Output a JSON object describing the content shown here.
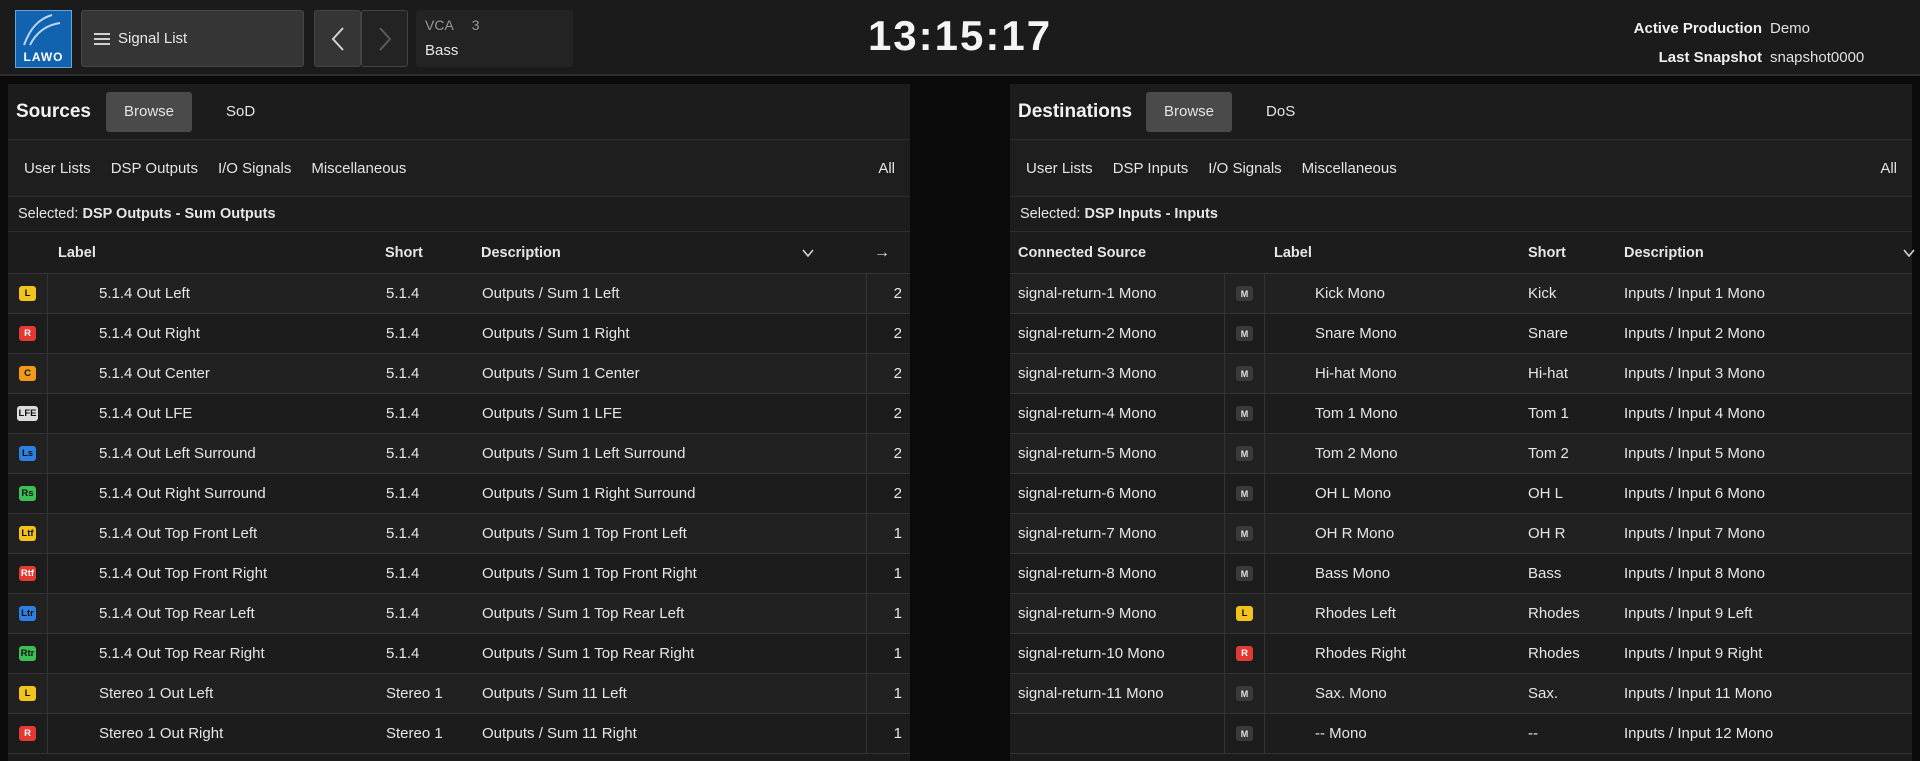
{
  "header": {
    "logo_text": "LAWO",
    "menu_label": "Signal List",
    "vca_label": "VCA",
    "vca_number": "3",
    "vca_name": "Bass",
    "clock": "13:15:17",
    "active_production_label": "Active Production",
    "active_production_value": "Demo",
    "last_snapshot_label": "Last Snapshot",
    "last_snapshot_value": "snapshot0000"
  },
  "sources": {
    "title": "Sources",
    "tabs": [
      "Browse",
      "SoD"
    ],
    "filters": [
      "User Lists",
      "DSP Outputs",
      "I/O Signals",
      "Miscellaneous"
    ],
    "filter_all": "All",
    "selected_prefix": "Selected:",
    "selected_value": "DSP Outputs - Sum Outputs",
    "columns": {
      "label": "Label",
      "short": "Short",
      "description": "Description",
      "arrow": "→"
    },
    "rows": [
      {
        "badge": "L",
        "badge_color": "#f2c31c",
        "label": "5.1.4 Out Left",
        "short": "5.1.4",
        "description": "Outputs / Sum 1 Left",
        "count": "2"
      },
      {
        "badge": "R",
        "badge_color": "#e23a32",
        "label": "5.1.4 Out Right",
        "short": "5.1.4",
        "description": "Outputs / Sum 1 Right",
        "count": "2"
      },
      {
        "badge": "C",
        "badge_color": "#f09a1a",
        "label": "5.1.4 Out Center",
        "short": "5.1.4",
        "description": "Outputs / Sum 1 Center",
        "count": "2"
      },
      {
        "badge": "LFE",
        "badge_color": "#dcdcdc",
        "label": "5.1.4 Out LFE",
        "short": "5.1.4",
        "description": "Outputs / Sum 1 LFE",
        "count": "2"
      },
      {
        "badge": "Ls",
        "badge_color": "#2d7fe0",
        "label": "5.1.4 Out Left Surround",
        "short": "5.1.4",
        "description": "Outputs / Sum 1 Left Surround",
        "count": "2"
      },
      {
        "badge": "Rs",
        "badge_color": "#3cbf55",
        "label": "5.1.4 Out Right Surround",
        "short": "5.1.4",
        "description": "Outputs / Sum 1 Right Surround",
        "count": "2"
      },
      {
        "badge": "Ltf",
        "badge_color": "#f2c31c",
        "label": "5.1.4 Out Top Front Left",
        "short": "5.1.4",
        "description": "Outputs / Sum 1 Top Front Left",
        "count": "1"
      },
      {
        "badge": "Rtf",
        "badge_color": "#e23a32",
        "label": "5.1.4 Out Top Front Right",
        "short": "5.1.4",
        "description": "Outputs / Sum 1 Top Front Right",
        "count": "1"
      },
      {
        "badge": "Ltr",
        "badge_color": "#2d7fe0",
        "label": "5.1.4 Out Top Rear Left",
        "short": "5.1.4",
        "description": "Outputs / Sum 1 Top Rear Left",
        "count": "1"
      },
      {
        "badge": "Rtr",
        "badge_color": "#3cbf55",
        "label": "5.1.4 Out Top Rear Right",
        "short": "5.1.4",
        "description": "Outputs / Sum 1 Top Rear Right",
        "count": "1"
      },
      {
        "badge": "L",
        "badge_color": "#f2c31c",
        "label": "Stereo 1 Out Left",
        "short": "Stereo 1",
        "description": "Outputs / Sum 11 Left",
        "count": "1"
      },
      {
        "badge": "R",
        "badge_color": "#e23a32",
        "label": "Stereo 1 Out Right",
        "short": "Stereo 1",
        "description": "Outputs / Sum 11 Right",
        "count": "1"
      }
    ]
  },
  "destinations": {
    "title": "Destinations",
    "tabs": [
      "Browse",
      "DoS"
    ],
    "filters": [
      "User Lists",
      "DSP Inputs",
      "I/O Signals",
      "Miscellaneous"
    ],
    "filter_all": "All",
    "selected_prefix": "Selected:",
    "selected_value": "DSP Inputs - Inputs",
    "columns": {
      "connected_source": "Connected Source",
      "label": "Label",
      "short": "Short",
      "description": "Description"
    },
    "rows": [
      {
        "source": "signal-return-1 Mono",
        "badge": "M",
        "badge_color": "#3a3a3a",
        "label": "Kick Mono",
        "short": "Kick",
        "description": "Inputs / Input 1 Mono"
      },
      {
        "source": "signal-return-2 Mono",
        "badge": "M",
        "badge_color": "#3a3a3a",
        "label": "Snare Mono",
        "short": "Snare",
        "description": "Inputs / Input 2 Mono"
      },
      {
        "source": "signal-return-3 Mono",
        "badge": "M",
        "badge_color": "#3a3a3a",
        "label": "Hi-hat Mono",
        "short": "Hi-hat",
        "description": "Inputs / Input 3 Mono"
      },
      {
        "source": "signal-return-4 Mono",
        "badge": "M",
        "badge_color": "#3a3a3a",
        "label": "Tom 1 Mono",
        "short": "Tom 1",
        "description": "Inputs / Input 4 Mono"
      },
      {
        "source": "signal-return-5 Mono",
        "badge": "M",
        "badge_color": "#3a3a3a",
        "label": "Tom 2 Mono",
        "short": "Tom 2",
        "description": "Inputs / Input 5 Mono"
      },
      {
        "source": "signal-return-6 Mono",
        "badge": "M",
        "badge_color": "#3a3a3a",
        "label": "OH L Mono",
        "short": "OH L",
        "description": "Inputs / Input 6 Mono"
      },
      {
        "source": "signal-return-7 Mono",
        "badge": "M",
        "badge_color": "#3a3a3a",
        "label": "OH R Mono",
        "short": "OH R",
        "description": "Inputs / Input 7 Mono"
      },
      {
        "source": "signal-return-8 Mono",
        "badge": "M",
        "badge_color": "#3a3a3a",
        "label": "Bass Mono",
        "short": "Bass",
        "description": "Inputs / Input 8 Mono"
      },
      {
        "source": "signal-return-9 Mono",
        "badge": "L",
        "badge_color": "#f2c31c",
        "label": "Rhodes Left",
        "short": "Rhodes",
        "description": "Inputs / Input 9 Left"
      },
      {
        "source": "signal-return-10 Mono",
        "badge": "R",
        "badge_color": "#e23a32",
        "label": "Rhodes Right",
        "short": "Rhodes",
        "description": "Inputs / Input 9 Right"
      },
      {
        "source": "signal-return-11 Mono",
        "badge": "M",
        "badge_color": "#3a3a3a",
        "label": "Sax. Mono",
        "short": "Sax.",
        "description": "Inputs / Input 11 Mono"
      },
      {
        "source": "",
        "badge": "M",
        "badge_color": "#3a3a3a",
        "label": "-- Mono",
        "short": "--",
        "description": "Inputs / Input 12 Mono"
      }
    ]
  }
}
